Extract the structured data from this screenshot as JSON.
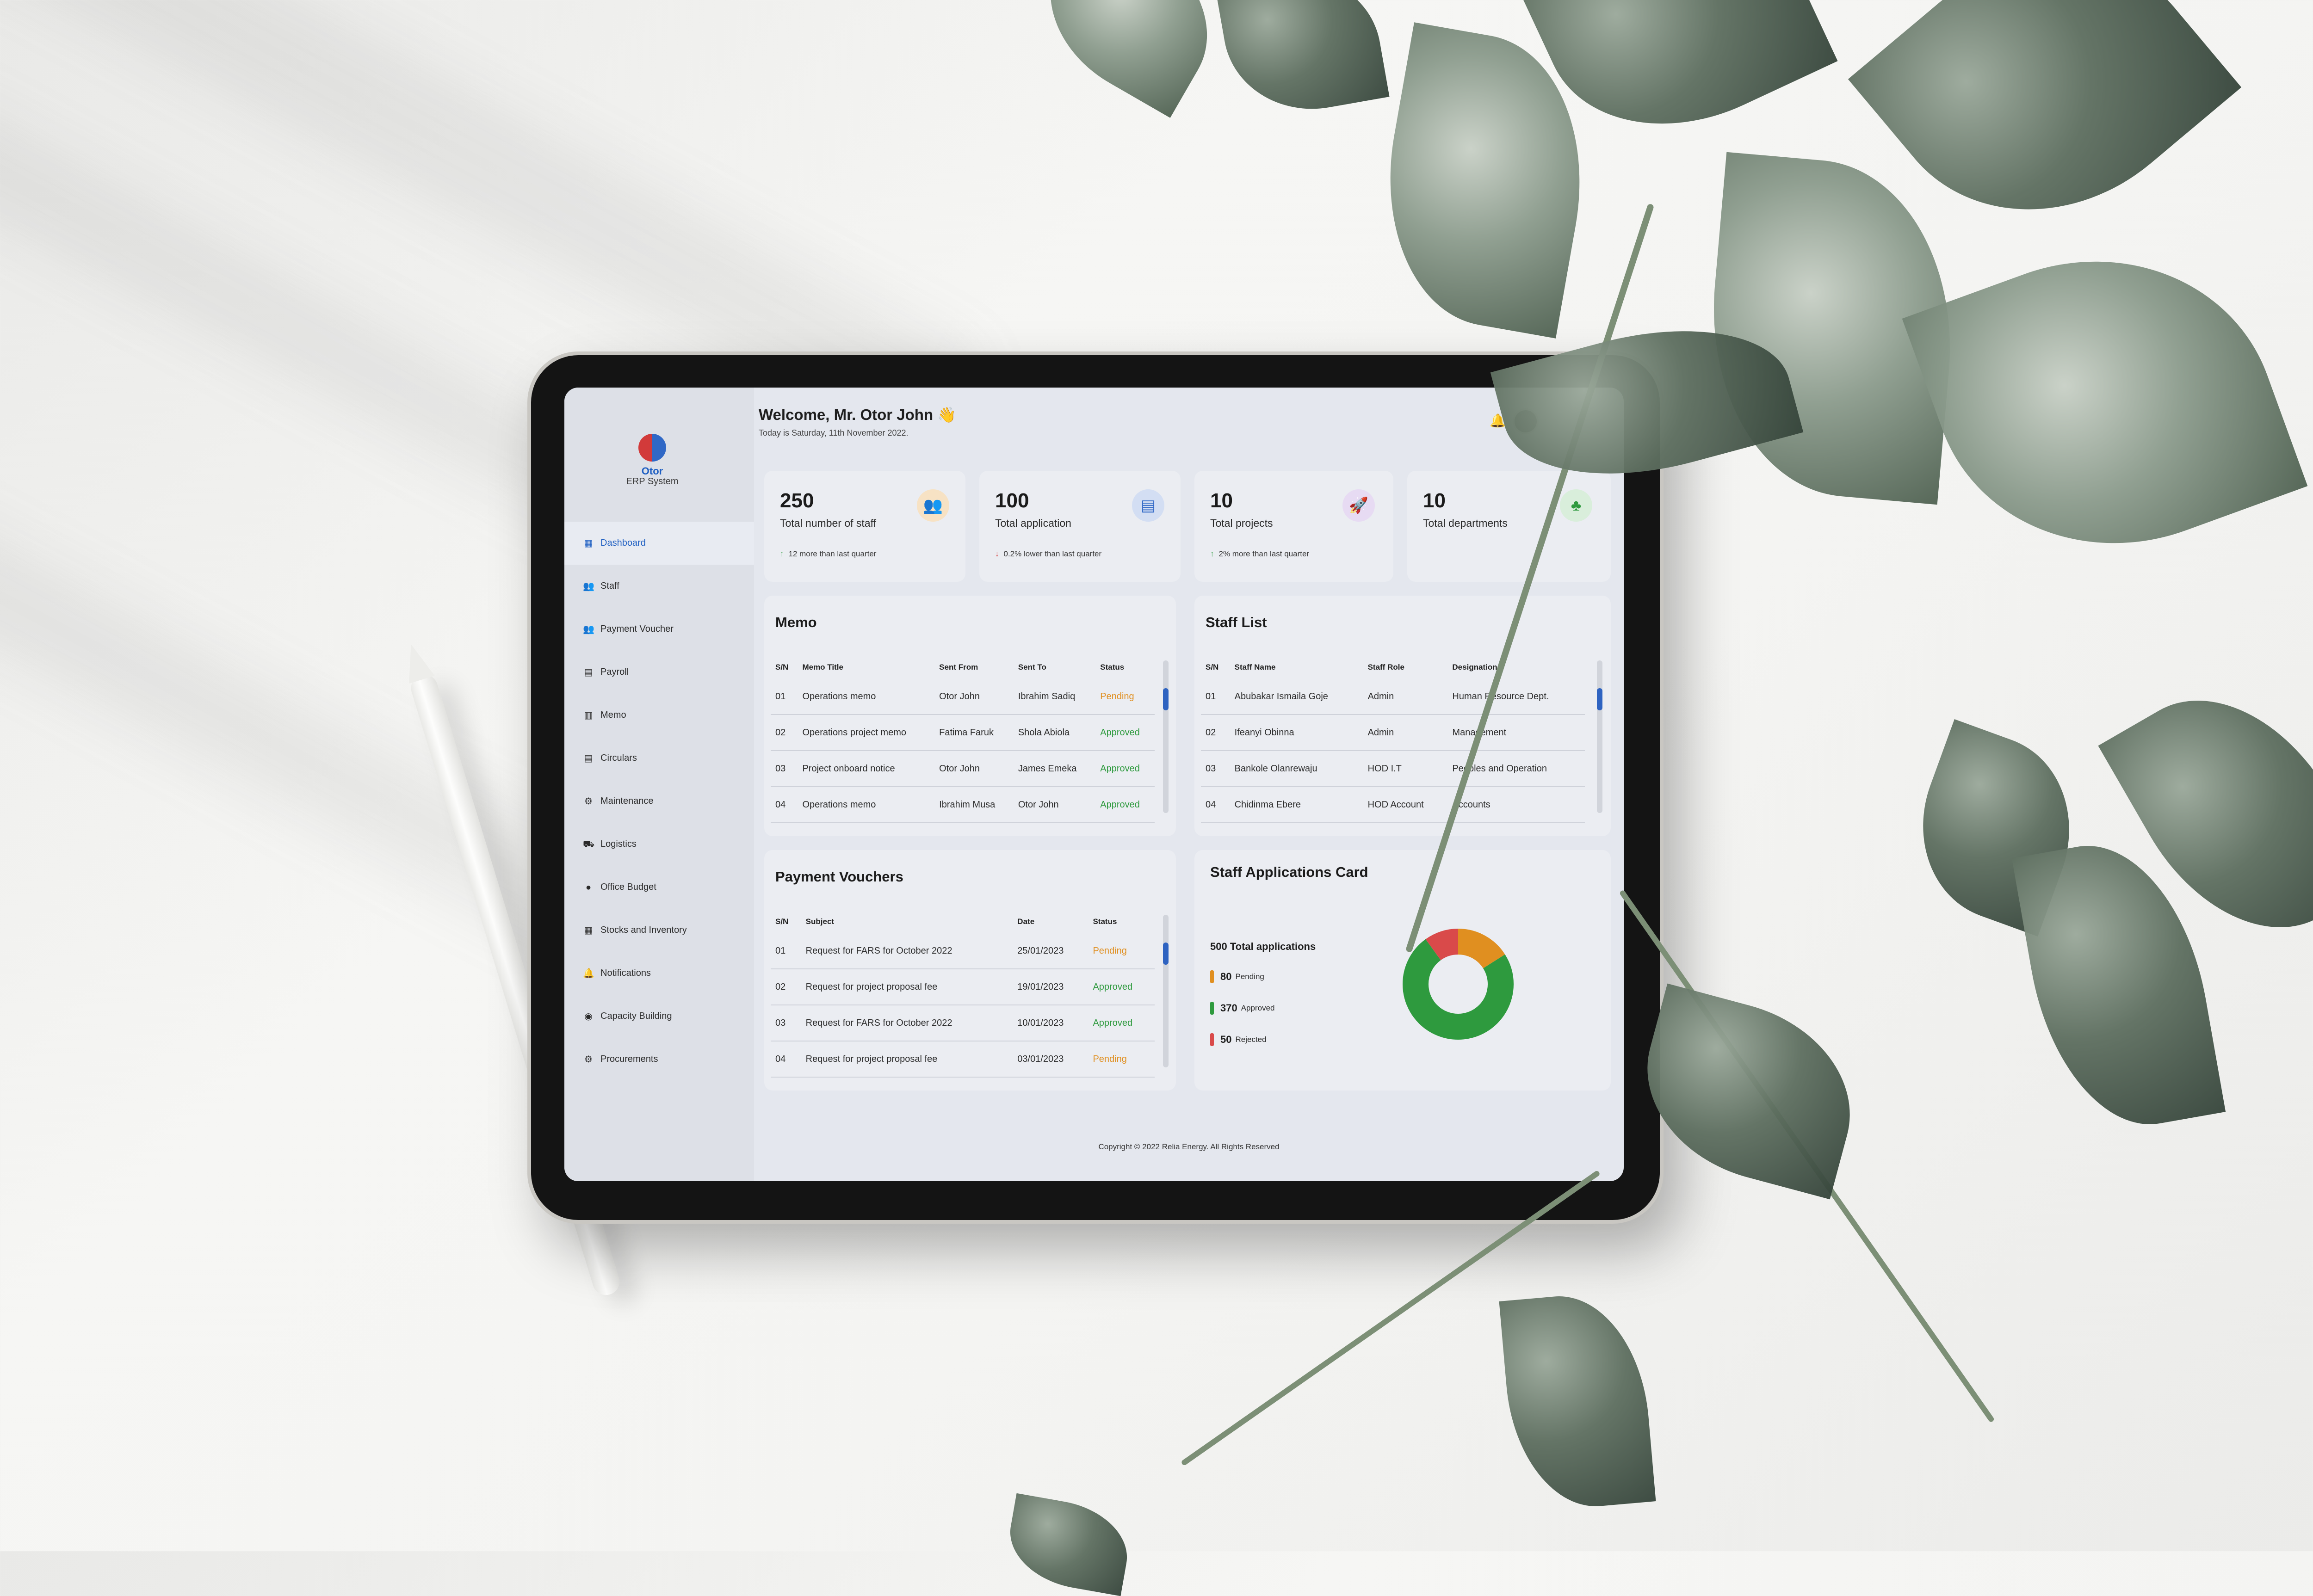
{
  "app": {
    "brand_name": "Otor",
    "brand_subtitle": "ERP System"
  },
  "header": {
    "welcome": "Welcome, Mr. Otor John 👋",
    "date_text": "Today is Saturday, 11th November 2022."
  },
  "sidebar": {
    "items": [
      {
        "label": "Dashboard",
        "icon": "dashboard-grid-icon",
        "active": true
      },
      {
        "label": "Staff",
        "icon": "users-icon"
      },
      {
        "label": "Payment Voucher",
        "icon": "users-icon"
      },
      {
        "label": "Payroll",
        "icon": "document-icon"
      },
      {
        "label": "Memo",
        "icon": "memo-icon"
      },
      {
        "label": "Circulars",
        "icon": "document-icon"
      },
      {
        "label": "Maintenance",
        "icon": "gear-icon"
      },
      {
        "label": "Logistics",
        "icon": "truck-icon"
      },
      {
        "label": "Office Budget",
        "icon": "money-bag-icon"
      },
      {
        "label": "Stocks and Inventory",
        "icon": "inventory-icon"
      },
      {
        "label": "Notifications",
        "icon": "bell-icon"
      },
      {
        "label": "Capacity Building",
        "icon": "building-icon"
      },
      {
        "label": "Procurements",
        "icon": "cart-icon"
      }
    ]
  },
  "stats": [
    {
      "value": "250",
      "label": "Total number of staff",
      "trend": "12 more than last quarter",
      "trend_dir": "up",
      "icon": "staff-icon",
      "icon_color": "#f2a23a"
    },
    {
      "value": "100",
      "label": "Total application",
      "trend": "0.2% lower than last quarter",
      "trend_dir": "down",
      "icon": "application-icon",
      "icon_color": "#3068c6"
    },
    {
      "value": "10",
      "label": "Total projects",
      "trend": "2% more than last quarter",
      "trend_dir": "up",
      "icon": "rocket-icon",
      "icon_color": "#8a3ad6"
    },
    {
      "value": "10",
      "label": "Total departments",
      "trend": "",
      "trend_dir": "",
      "icon": "org-chart-icon",
      "icon_color": "#2e9a3e"
    }
  ],
  "memo": {
    "title": "Memo",
    "headers": [
      "S/N",
      "Memo Title",
      "Sent From",
      "Sent To",
      "Status"
    ],
    "rows": [
      [
        "01",
        "Operations memo",
        "Otor John",
        "Ibrahim Sadiq",
        "Pending"
      ],
      [
        "02",
        "Operations project memo",
        "Fatima Faruk",
        "Shola Abiola",
        "Approved"
      ],
      [
        "03",
        "Project onboard notice",
        "Otor John",
        "James Emeka",
        "Approved"
      ],
      [
        "04",
        "Operations memo",
        "Ibrahim Musa",
        "Otor John",
        "Approved"
      ]
    ]
  },
  "staff_list": {
    "title": "Staff List",
    "headers": [
      "S/N",
      "Staff Name",
      "Staff Role",
      "Designation"
    ],
    "rows": [
      [
        "01",
        "Abubakar Ismaila Goje",
        "Admin",
        "Human Resource Dept."
      ],
      [
        "02",
        "Ifeanyi Obinna",
        "Admin",
        "Management"
      ],
      [
        "03",
        "Bankole Olanrewaju",
        "HOD I.T",
        "Peoples and Operation"
      ],
      [
        "04",
        "Chidinma Ebere",
        "HOD Account",
        "Accounts"
      ]
    ]
  },
  "payment_vouchers": {
    "title": "Payment Vouchers",
    "headers": [
      "S/N",
      "Subject",
      "Date",
      "Status"
    ],
    "rows": [
      [
        "01",
        "Request for FARS for October 2022",
        "25/01/2023",
        "Pending"
      ],
      [
        "02",
        "Request for project proposal fee",
        "19/01/2023",
        "Approved"
      ],
      [
        "03",
        "Request for FARS for October 2022",
        "10/01/2023",
        "Approved"
      ],
      [
        "04",
        "Request for project proposal fee",
        "03/01/2023",
        "Pending"
      ]
    ]
  },
  "staff_applications": {
    "title": "Staff Applications Card",
    "total_text": "500 Total applications",
    "legend": [
      {
        "value": "80",
        "label": "Pending",
        "color": "#e08f20"
      },
      {
        "value": "370",
        "label": "Approved",
        "color": "#2e9a3e"
      },
      {
        "value": "50",
        "label": "Rejected",
        "color": "#d94a4a"
      }
    ]
  },
  "footer": {
    "copyright": "Copyright © 2022 Relia Energy. All Rights Reserved"
  },
  "colors": {
    "accent": "#1f5fc2",
    "pending": "#e08f20",
    "approved": "#2e9a3e",
    "rejected": "#d94a4a"
  }
}
